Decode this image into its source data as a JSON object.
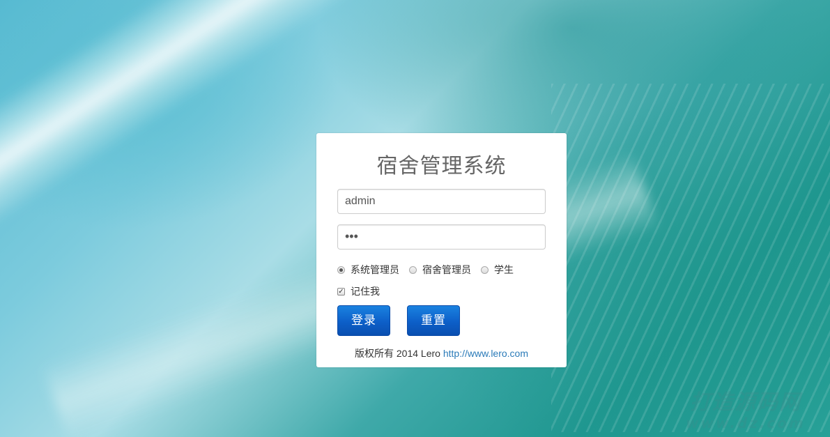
{
  "app": {
    "title": "宿舍管理系统"
  },
  "login_form": {
    "username_value": "admin",
    "password_value": "•••",
    "roles": [
      {
        "label": "系统管理员",
        "checked": true
      },
      {
        "label": "宿舍管理员",
        "checked": false
      },
      {
        "label": "学生",
        "checked": false
      }
    ],
    "remember_label": "记住我",
    "remember_checked": true,
    "login_label": "登录",
    "reset_label": "重置"
  },
  "footer": {
    "copyright_text": "版权所有 2014 Lero ",
    "link_text": "http://www.lero.com"
  },
  "watermark": {
    "line1": "打造源码网",
    "line2": "www.dz.com"
  },
  "colors": {
    "button_blue": "#0d5fc8",
    "link_blue": "#2a7ab8",
    "title_gray": "#666666"
  }
}
